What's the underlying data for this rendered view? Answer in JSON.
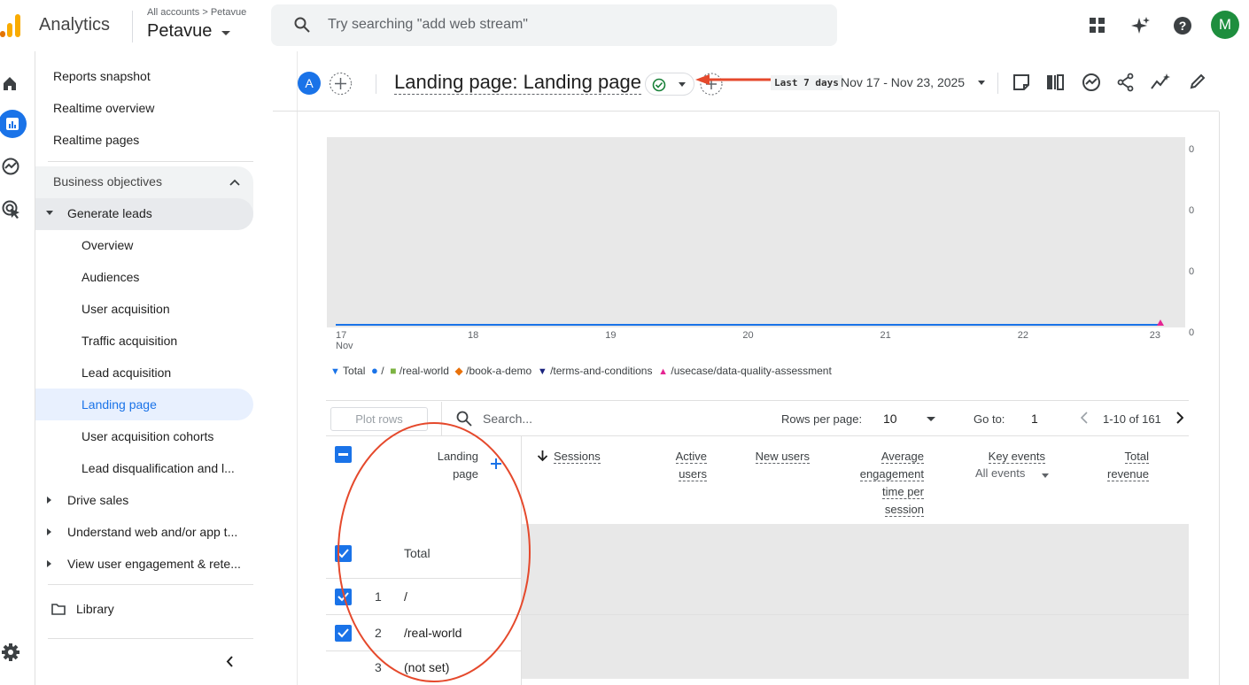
{
  "app": {
    "name": "Analytics",
    "breadcrumb": "All accounts > Petavue",
    "property": "Petavue",
    "brand_color": "#f9ab00",
    "accent_color": "#1a73e8"
  },
  "search": {
    "placeholder": "Try searching \"add web stream\""
  },
  "topbar_icons": [
    "apps-icon",
    "sparkle-icon",
    "help-icon"
  ],
  "avatar": {
    "letter": "M",
    "color": "#1e8e3e"
  },
  "rail_icons": [
    "home-icon",
    "reports-icon",
    "explore-icon",
    "advertising-icon",
    "settings-icon"
  ],
  "nav": {
    "reports_snapshot": "Reports snapshot",
    "realtime_overview": "Realtime overview",
    "realtime_pages": "Realtime pages",
    "business_objectives": "Business objectives",
    "generate_leads": "Generate leads",
    "sub_items": [
      "Overview",
      "Audiences",
      "User acquisition",
      "Traffic acquisition",
      "Lead acquisition",
      "Landing page",
      "User acquisition cohorts",
      "Lead disqualification and l..."
    ],
    "drive_sales": "Drive sales",
    "understand": "Understand web and/or app t...",
    "engagement": "View user engagement & rete...",
    "library": "Library"
  },
  "report": {
    "avatar_letter": "A",
    "title": "Landing page: Landing page",
    "date_chip": "Last 7 days",
    "date_range": "Nov 17 - Nov 23, 2025"
  },
  "chart_data": {
    "type": "line",
    "x": [
      "17 Nov",
      "18",
      "19",
      "20",
      "21",
      "22",
      "23"
    ],
    "y_ticks": [
      "0",
      "0",
      "0",
      "0"
    ],
    "series": [
      {
        "name": "Total",
        "values": [
          0,
          0,
          0,
          0,
          0,
          0,
          0
        ],
        "color": "#1a73e8"
      },
      {
        "name": "/",
        "values": [
          0,
          0,
          0,
          0,
          0,
          0,
          0
        ],
        "color": "#1a73e8"
      },
      {
        "name": "/real-world",
        "values": [
          0,
          0,
          0,
          0,
          0,
          0,
          0
        ],
        "color": "#7cb342"
      },
      {
        "name": "/book-a-demo",
        "values": [
          0,
          0,
          0,
          0,
          0,
          0,
          0
        ],
        "color": "#e8710a"
      },
      {
        "name": "/terms-and-conditions",
        "values": [
          0,
          0,
          0,
          0,
          0,
          0,
          0
        ],
        "color": "#1a237e"
      },
      {
        "name": "/usecase/data-quality-assessment",
        "values": [
          0,
          0,
          0,
          0,
          0,
          0,
          0
        ],
        "color": "#e52592"
      }
    ]
  },
  "table": {
    "plot_rows": "Plot rows",
    "search_placeholder": "Search...",
    "rows_per_page_label": "Rows per page:",
    "rows_per_page": "10",
    "goto_label": "Go to:",
    "goto_value": "1",
    "pagination": "1-10 of 161",
    "headers": {
      "landing_page": [
        "Landing",
        "page"
      ],
      "sessions": "Sessions",
      "active_users": [
        "Active",
        "users"
      ],
      "new_users": "New users",
      "avg_engagement": [
        "Average",
        "engagement",
        "time per",
        "session"
      ],
      "key_events": "Key events",
      "key_events_sub": "All events",
      "total_revenue": [
        "Total",
        "revenue"
      ]
    },
    "total_label": "Total",
    "rows": [
      {
        "num": "1",
        "page": "/"
      },
      {
        "num": "2",
        "page": "/real-world"
      },
      {
        "num": "3",
        "page": "(not set)"
      }
    ]
  }
}
